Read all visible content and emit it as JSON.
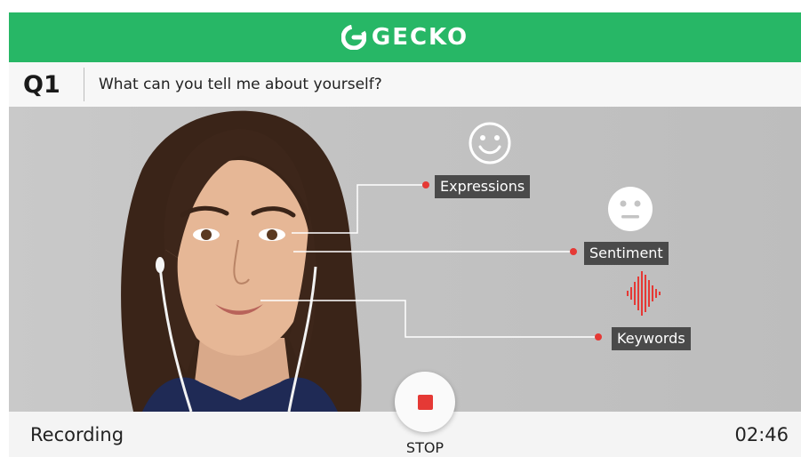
{
  "header": {
    "logo_icon": "gecko-logo-icon",
    "title": "GECKO",
    "background": "#27b766"
  },
  "question": {
    "number": "Q1",
    "text": "What can you tell me about yourself?"
  },
  "analysis": {
    "expressions_label": "Expressions",
    "sentiment_label": "Sentiment",
    "keywords_label": "Keywords",
    "marker_color": "#e53935",
    "tag_color": "#4a4a4a"
  },
  "footer": {
    "status": "Recording",
    "stop_label": "STOP",
    "timer": "02:46"
  }
}
